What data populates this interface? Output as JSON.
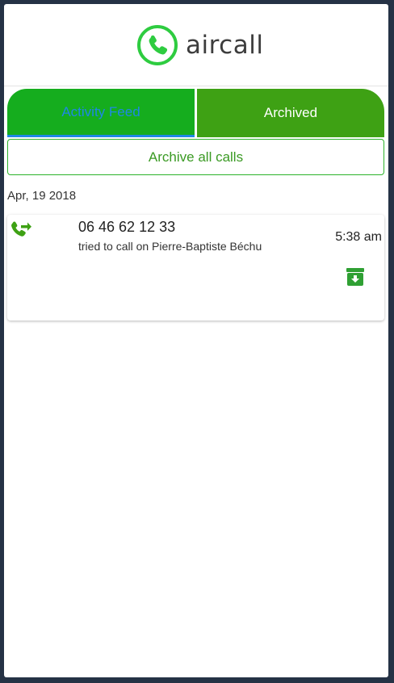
{
  "header": {
    "brand": "aircall",
    "brand_color": "#2ecc40"
  },
  "tabs": [
    {
      "label": "Activity Feed",
      "active": true
    },
    {
      "label": "Archived",
      "active": false
    }
  ],
  "archive_all_label": "Archive all calls",
  "feed": {
    "date": "Apr, 19 2018",
    "calls": [
      {
        "number": "06 46 62 12 33",
        "description": "tried to call on Pierre-Baptiste Béchu",
        "time": "5:38 am",
        "type_icon": "phone-forward-icon",
        "action_icon": "archive-box-icon"
      }
    ]
  },
  "colors": {
    "accent_green": "#15ad1e",
    "dark_green": "#3ea114",
    "link_blue": "#1e88e5",
    "frame_bg": "#253245"
  }
}
